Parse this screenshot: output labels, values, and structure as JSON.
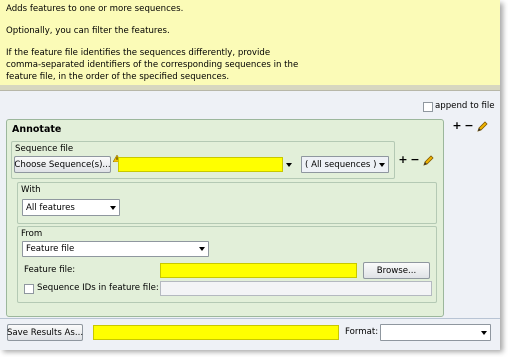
{
  "help": {
    "line1": "Adds features to one or more sequences.",
    "line2": "Optionally, you can filter the features.",
    "line3": "If the feature file identifies the sequences differently, provide",
    "line4": "comma-separated identifiers of the corresponding sequences in the",
    "line5": "feature file, in the order of the specified sequences."
  },
  "append_label": "append to file",
  "annotate": {
    "title": "Annotate",
    "sequence_file": {
      "label": "Sequence file",
      "choose_button": "Choose Sequence(s)...",
      "sequence_select": "( All sequences )"
    },
    "with": {
      "label": "With",
      "select": "All features"
    },
    "from": {
      "label": "From",
      "select": "Feature file",
      "feature_file_label": "Feature file:",
      "browse_button": "Browse...",
      "seq_ids_label": "Sequence IDs in feature file:"
    }
  },
  "bottom": {
    "save_button": "Save Results As...",
    "format_label": "Format:"
  },
  "icons": [
    "plus-icon",
    "minus-icon",
    "pencil-icon",
    "warning-icon",
    "chevron-down-icon"
  ],
  "colors": {
    "required_field": "#ffff00",
    "help_background": "#fbfbb7",
    "group_background": "#e2efd9"
  }
}
